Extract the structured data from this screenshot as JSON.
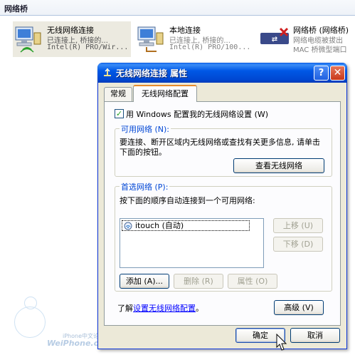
{
  "explorer": {
    "section_title": "网络桥",
    "connections": [
      {
        "title": "无线网络连接",
        "status": "已连接上, 桥接的...",
        "device": "Intel(R) PRO/Wir..."
      },
      {
        "title": "本地连接",
        "status": "已连接上, 桥接的...",
        "device": "Intel(R) PRO/100..."
      },
      {
        "title": "网络桥 (网络桥)",
        "status": "网络电缆被拔出",
        "device": "MAC 桥微型端口"
      }
    ]
  },
  "watermark": {
    "line1": "iPhone中文论坛",
    "line2": "WeiPhone.com"
  },
  "dialog": {
    "title": "无线网络连接 属性",
    "help_label": "?",
    "close_label": "✕",
    "tabs": {
      "general": "常规",
      "wireless": "无线网络配置"
    },
    "use_windows_label": "用 Windows 配置我的无线网络设置 (W)",
    "available": {
      "legend": "可用网络 (N):",
      "description": "要连接、断开区域内无线网络或查找有关更多信息, 请单击下面的按钮。",
      "view_button": "查看无线网络"
    },
    "preferred": {
      "legend": "首选网络 (P):",
      "description": "按下面的顺序自动连接到一个可用网络:",
      "networks": [
        {
          "name": "itouch (自动)"
        }
      ],
      "move_up": "上移 (U)",
      "move_down": "下移 (D)",
      "add": "添加 (A)...",
      "remove": "删除 (R)",
      "properties": "属性 (O)"
    },
    "learn_prefix": "了解",
    "learn_link": "设置无线网络配置",
    "learn_suffix": "。",
    "advanced": "高级 (V)",
    "ok": "确定",
    "cancel": "取消"
  }
}
